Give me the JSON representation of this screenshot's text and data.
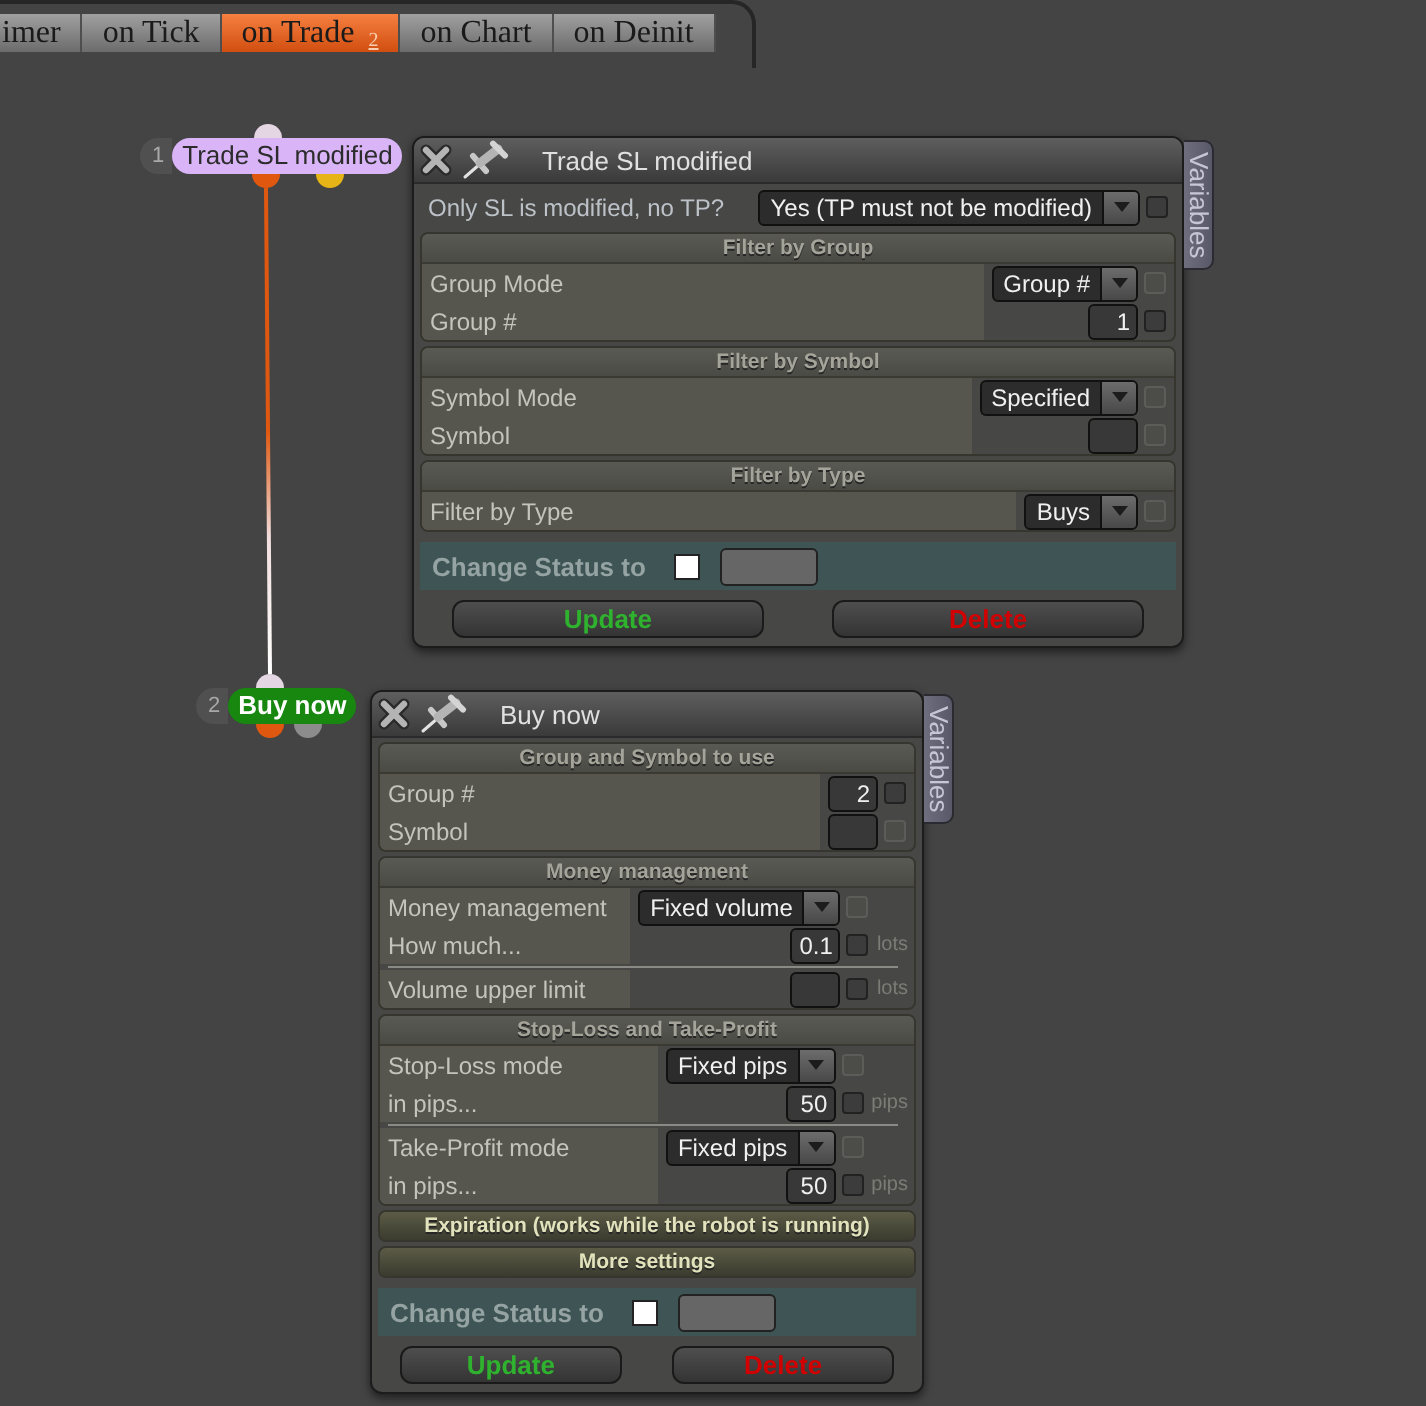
{
  "tabs": [
    {
      "label": "imer",
      "selected": false
    },
    {
      "label": "on Tick",
      "selected": false
    },
    {
      "label": "on Trade $_{2}$",
      "selected": true
    },
    {
      "label": "on Chart",
      "selected": false
    },
    {
      "label": "on Deinit",
      "selected": false
    }
  ],
  "nodes": [
    {
      "number": "1",
      "label": "Trade SL modified",
      "kind": "trigger",
      "color": "#d9b4f7",
      "outputs": [
        {
          "color": "#e0580f",
          "connected": true
        },
        {
          "color": "#e6b417"
        }
      ]
    },
    {
      "number": "2",
      "label": "Buy now",
      "kind": "action",
      "color": "#17870f",
      "outputs": [
        {
          "color": "#e0580f"
        },
        {
          "color": "#8c8c8c"
        }
      ]
    }
  ],
  "panels": [
    {
      "title": "Trade SL modified",
      "side_tab": "Variables",
      "top_rows": [
        {
          "kind": "select",
          "label": "Only SL is modified, no TP?",
          "value": "Yes (TP must not be modified)",
          "checked": false,
          "checkbox_disabled": false
        }
      ],
      "sections": [
        {
          "title": "Filter by Group",
          "expanded": true,
          "rows": [
            {
              "kind": "select",
              "label": "Group Mode",
              "value": "Group #",
              "checked": false,
              "checkbox_disabled": true
            },
            {
              "kind": "input",
              "label": "Group #",
              "value": "1",
              "checked": false,
              "checkbox_disabled": false
            }
          ]
        },
        {
          "title": "Filter by Symbol",
          "expanded": true,
          "rows": [
            {
              "kind": "select",
              "label": "Symbol Mode",
              "value": "Specified",
              "checked": false,
              "checkbox_disabled": true
            },
            {
              "kind": "input",
              "label": "Symbol",
              "checked": false,
              "checkbox_disabled": true
            }
          ]
        },
        {
          "title": "Filter by Type",
          "expanded": true,
          "rows": [
            {
              "kind": "select",
              "label": "Filter by Type",
              "value": "Buys",
              "checked": false,
              "checkbox_disabled": true
            }
          ]
        }
      ],
      "status": {
        "label": "Change Status to",
        "checked": false
      },
      "buttons": [
        {
          "label": "Update",
          "kind": "update"
        },
        {
          "label": "Delete",
          "kind": "delete"
        }
      ]
    },
    {
      "title": "Buy now",
      "side_tab": "Variables",
      "sections": [
        {
          "title": "Group and Symbol to use",
          "expanded": true,
          "rows": [
            {
              "kind": "input",
              "label": "Group #",
              "value": "2",
              "checked": false,
              "checkbox_disabled": false
            },
            {
              "kind": "input",
              "label": "Symbol",
              "checked": false,
              "checkbox_disabled": true
            }
          ]
        },
        {
          "title": "Money management",
          "expanded": true,
          "rows": [
            {
              "kind": "select",
              "label": "Money management",
              "value": "Fixed volume",
              "checked": false,
              "checkbox_disabled": true
            },
            {
              "kind": "input",
              "label": "How much...",
              "value": "0.1",
              "unit": "lots",
              "checked": false,
              "checkbox_disabled": false
            },
            {
              "kind": "input",
              "label": "Volume upper limit",
              "unit": "lots",
              "separator_before": true,
              "checked": false,
              "checkbox_disabled": false
            }
          ]
        },
        {
          "title": "Stop-Loss and Take-Profit",
          "expanded": true,
          "rows": [
            {
              "kind": "select",
              "label": "Stop-Loss mode",
              "value": "Fixed pips",
              "checked": false,
              "checkbox_disabled": true
            },
            {
              "kind": "input",
              "label": "in pips...",
              "value": "50",
              "unit": "pips",
              "checked": false,
              "checkbox_disabled": false
            },
            {
              "kind": "select",
              "label": "Take-Profit mode",
              "value": "Fixed pips",
              "separator_before": true,
              "checked": false,
              "checkbox_disabled": true
            },
            {
              "kind": "input",
              "label": "in pips...",
              "value": "50",
              "unit": "pips",
              "checked": false,
              "checkbox_disabled": false
            }
          ]
        },
        {
          "title": "Expiration (works while the robot is running)",
          "expanded": false
        },
        {
          "title": "More settings",
          "expanded": false
        }
      ],
      "status": {
        "label": "Change Status to",
        "checked": false
      },
      "buttons": [
        {
          "label": "Update",
          "kind": "update"
        },
        {
          "label": "Delete",
          "kind": "delete"
        }
      ]
    }
  ]
}
